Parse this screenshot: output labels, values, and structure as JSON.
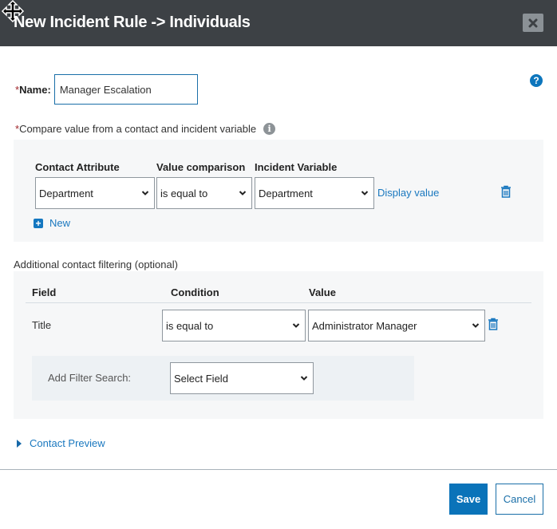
{
  "dialog": {
    "title": "New Incident Rule -> Individuals",
    "close_icon": "close-icon",
    "help_icon": "question-circle-icon",
    "cursor_icon": "move-cursor-icon"
  },
  "name_field": {
    "required_marker": "*",
    "label": "Name:",
    "value": "Manager Escalation"
  },
  "compare_section": {
    "required_marker": "*",
    "label": "Compare value from a contact and incident variable",
    "info_icon": "info-circle-icon",
    "info_glyph": "i",
    "columns": [
      "Contact Attribute",
      "Value comparison",
      "Incident Variable"
    ],
    "rows": [
      {
        "contact_attribute": "Department",
        "value_comparison": "is equal to",
        "incident_variable": "Department",
        "display_value_link": "Display value",
        "delete_icon": "trash-icon"
      }
    ],
    "new_button": {
      "icon": "plus-square-icon",
      "glyph": "+",
      "label": "New"
    }
  },
  "additional_filtering": {
    "label": "Additional contact filtering (optional)",
    "columns": [
      "Field",
      "Condition",
      "Value"
    ],
    "rows": [
      {
        "field": "Title",
        "condition": "is equal to",
        "value": "Administrator Manager",
        "delete_icon": "trash-icon"
      }
    ],
    "add_filter": {
      "label": "Add Filter Search:",
      "selected": "Select Field"
    }
  },
  "contact_preview": {
    "label": "Contact Preview",
    "expanded": false
  },
  "footer": {
    "save_label": "Save",
    "cancel_label": "Cancel"
  },
  "colors": {
    "header_bg": "#3d4145",
    "primary": "#0a73b9",
    "link": "#1a78bf",
    "required": "#a0282d",
    "panel_bg": "#f6f7f8"
  }
}
